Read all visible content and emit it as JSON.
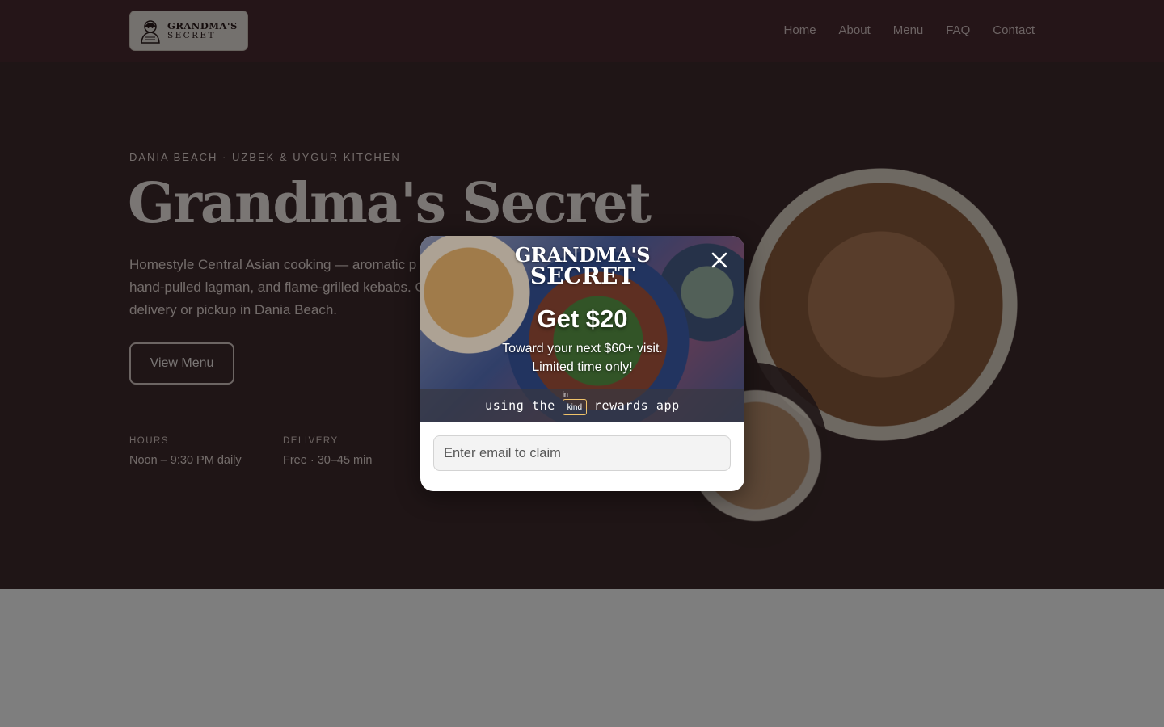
{
  "header": {
    "logo": {
      "line1": "GRANDMA'S",
      "line2": "SECRET",
      "icon": "grandma-emblem-icon"
    },
    "nav": [
      "Home",
      "About",
      "Menu",
      "FAQ",
      "Contact"
    ]
  },
  "hero": {
    "eyebrow": "DANIA BEACH · UZBEK & UYGUR KITCHEN",
    "title": "Grandma's Secret",
    "description": "Homestyle Central Asian cooking — aromatic p hand-pulled lagman, and flame-grilled kebabs. Order delivery or pickup in Dania Beach.",
    "cta": "View Menu",
    "info": [
      {
        "label": "HOURS",
        "value": "Noon – 9:30 PM daily"
      },
      {
        "label": "DELIVERY",
        "value": "Free · 30–45 min"
      }
    ]
  },
  "modal": {
    "brand_line1": "GRANDMA'S",
    "brand_line2": "SECRET",
    "close_icon": "close-icon",
    "offer_title": "Get $20",
    "offer_line1": "Toward your next $60+ visit.",
    "offer_line2": "Limited time only!",
    "rewards_prefix": "using the",
    "rewards_badge_top": "in",
    "rewards_badge_main": "kind",
    "rewards_suffix": "rewards app",
    "email_placeholder": "Enter email to claim"
  },
  "colors": {
    "navbar": "#4a2a31",
    "overlay": "rgba(0,0,0,0.5)",
    "badge_border": "#f0c36a"
  }
}
